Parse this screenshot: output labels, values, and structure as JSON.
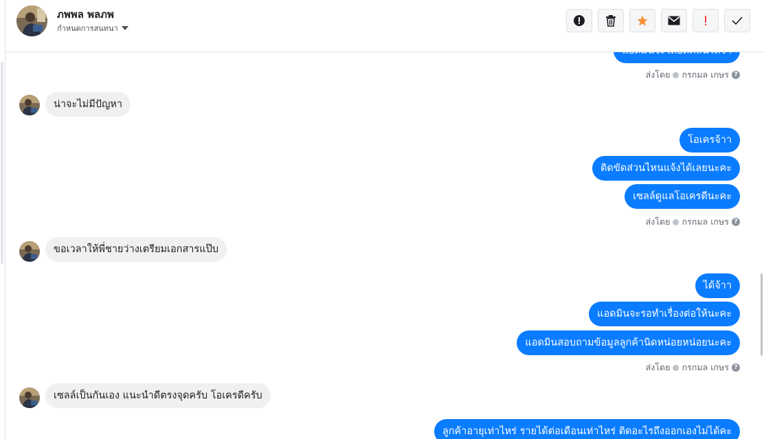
{
  "header": {
    "contact_name": "ภพพล พลภพ",
    "conversation_settings_label": "กำหนดการสนทนา"
  },
  "toolbar": {
    "buttons": [
      {
        "name": "mark-spam",
        "icon": "exclamation-circle-icon"
      },
      {
        "name": "delete",
        "icon": "trash-icon"
      },
      {
        "name": "star",
        "icon": "star-icon",
        "color": "#f7923a"
      },
      {
        "name": "mark-unread",
        "icon": "envelope-icon"
      },
      {
        "name": "follow-up",
        "icon": "exclamation-icon",
        "color": "#fa3e3e"
      },
      {
        "name": "mark-done",
        "icon": "checkmark-icon"
      }
    ]
  },
  "messages": {
    "out_top_clipped": "แอดมินจะได้ยืดคลีนให้จ้า",
    "sent_by_1": {
      "prefix": "ส่งโดย",
      "agent": "กรกมล เกษร"
    },
    "in_1": "น่าจะไม่มีปัญหา",
    "out_1": "โอเครจ้าา",
    "out_2": "ติดขัดส่วนไหนแจ้งได้เลยนะคะ",
    "out_3": "เซลล์ดูแลโอเครดีนะคะ",
    "sent_by_2": {
      "prefix": "ส่งโดย",
      "agent": "กรกมล เกษร"
    },
    "in_2": "ขอเวลาให้พี่ชายว่างเตรียมเอกสารแป๊บ",
    "out_4": "ได้จ้าา",
    "out_5": "แอดมินจะรอทำเรื่องต่อให้นะคะ",
    "out_6": "แอดมินสอบถามข้อมูลลูกค้านิดหน่อยหน่อยนะคะ",
    "sent_by_3": {
      "prefix": "ส่งโดย",
      "agent": "กรกมล เกษร"
    },
    "in_3": "เซลล์เป็นกันเอง แนะนำดีตรงจุดครับ โอเครดีครับ",
    "out_bottom_clipped": "ลูกค้าอายุเท่าไหร่ รายได้ต่อเดือนเท่าไหร่ ติดอะไรถึงออกเองไม่ได้คะ"
  },
  "colors": {
    "outgoing_bubble": "#0a7cff",
    "incoming_bubble": "#f0f0f0"
  }
}
